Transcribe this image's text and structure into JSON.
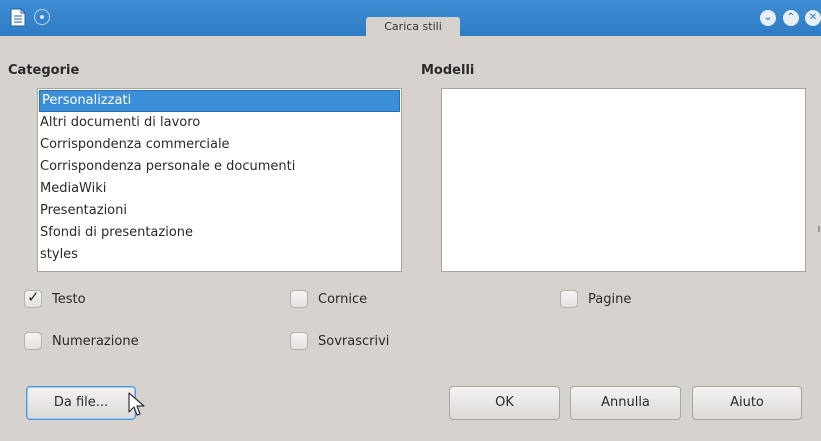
{
  "window": {
    "title": "Carica stili",
    "controls": [
      "minimize",
      "maximize",
      "close"
    ]
  },
  "categorie": {
    "heading": "Categorie",
    "items": [
      "Personalizzati",
      "Altri documenti di lavoro",
      "Corrispondenza commerciale",
      "Corrispondenza personale e documenti",
      "MediaWiki",
      "Presentazioni",
      "Sfondi di presentazione",
      "styles"
    ],
    "selected": "Personalizzati"
  },
  "modelli": {
    "heading": "Modelli",
    "items": []
  },
  "options": {
    "testo": {
      "label": "Testo",
      "checked": true
    },
    "cornice": {
      "label": "Cornice",
      "checked": false
    },
    "pagine": {
      "label": "Pagine",
      "checked": false
    },
    "numerazione": {
      "label": "Numerazione",
      "checked": false
    },
    "sovrascrivi": {
      "label": "Sovrascrivi",
      "checked": false
    }
  },
  "buttons": {
    "da_file": "Da file...",
    "ok": "OK",
    "annulla": "Annulla",
    "aiuto": "Aiuto"
  },
  "colors": {
    "titlebar": "#2e7cc4",
    "selection": "#3b8ed8",
    "dialog_bg": "#d6d2ce"
  }
}
